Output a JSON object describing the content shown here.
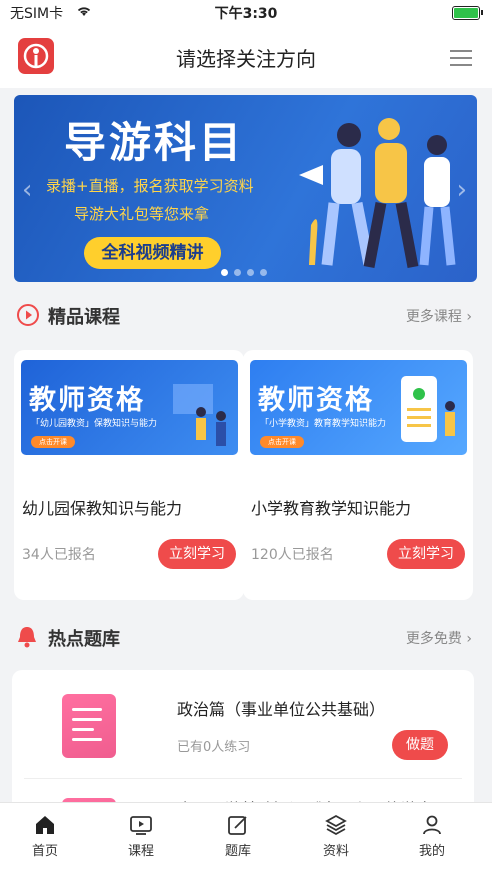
{
  "status_bar": {
    "carrier": "无SIM卡",
    "time": "下午3:30"
  },
  "navbar": {
    "title": "请选择关注方向",
    "logo": "app-logo",
    "menu_icon": "menu-icon"
  },
  "banner": {
    "title": "导游科目",
    "line1": "录播+直播，报名获取学习资料",
    "line2": "导游大礼包等您来拿",
    "button": "全科视频精讲",
    "slide_count": 4,
    "active_slide": 1
  },
  "courses": {
    "section_title": "精品课程",
    "more": "更多课程",
    "items": [
      {
        "thumb_title": "教师资格",
        "thumb_subtitle": "「幼儿园教资」保教知识与能力",
        "thumb_button": "点击开课",
        "name": "幼儿园保教知识与能力",
        "count": "34人已报名",
        "button": "立刻学习"
      },
      {
        "thumb_title": "教师资格",
        "thumb_subtitle": "「小学教资」教育教学知识能力",
        "thumb_button": "点击开课",
        "name": "小学教育教学知识能力",
        "count": "120人已报名",
        "button": "立刻学习"
      }
    ]
  },
  "questions": {
    "section_title": "热点题库",
    "more": "更多免费",
    "items": [
      {
        "title": "政治篇（事业单位公共基础）",
        "sub": "已有0人练习",
        "button": "做题"
      },
      {
        "title": "全国导游基础知识《中国主要旅游客"
      }
    ]
  },
  "tabbar": [
    {
      "label": "首页",
      "icon": "home-icon"
    },
    {
      "label": "课程",
      "icon": "tv-icon"
    },
    {
      "label": "题库",
      "icon": "edit-icon"
    },
    {
      "label": "资料",
      "icon": "layers-icon"
    },
    {
      "label": "我的",
      "icon": "user-icon"
    }
  ],
  "colors": {
    "accent": "#ef4b4b",
    "banner": "#1c56b8",
    "yellow": "#ffcf2c"
  }
}
